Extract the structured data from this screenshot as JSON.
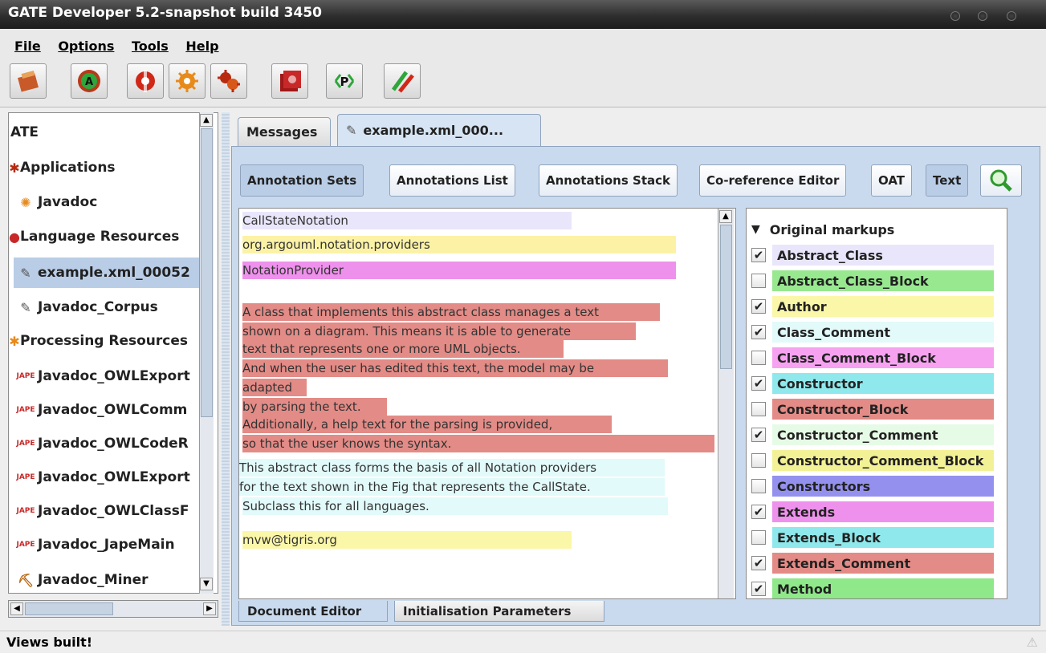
{
  "window": {
    "title": "GATE Developer 5.2-snapshot build 3450"
  },
  "menu": [
    "File",
    "Options",
    "Tools",
    "Help"
  ],
  "toolbar": {
    "icons": [
      "load-application-icon",
      "annie-icon",
      "new-language-resource-icon",
      "new-processing-resource-icon",
      "new-application-icon",
      "datastore-icon",
      "plugin-manager-icon",
      "annotation-diff-icon"
    ]
  },
  "tree": {
    "root": "ATE",
    "items": [
      {
        "label": "Applications",
        "icon": "applications-icon"
      },
      {
        "label": "Javadoc",
        "icon": "application-icon"
      },
      {
        "label": "Language Resources",
        "icon": "language-resources-icon"
      },
      {
        "label": "example.xml_00052",
        "icon": "document-icon"
      },
      {
        "label": "Javadoc_Corpus",
        "icon": "corpus-icon"
      },
      {
        "label": "Processing Resources",
        "icon": "processing-resources-icon"
      },
      {
        "label": "Javadoc_OWLExport",
        "icon": "jape-icon"
      },
      {
        "label": "Javadoc_OWLComm",
        "icon": "jape-icon"
      },
      {
        "label": "Javadoc_OWLCodeR",
        "icon": "jape-icon"
      },
      {
        "label": "Javadoc_OWLExport",
        "icon": "jape-icon"
      },
      {
        "label": "Javadoc_OWLClassF",
        "icon": "jape-icon"
      },
      {
        "label": "Javadoc_JapeMain",
        "icon": "jape-icon"
      },
      {
        "label": "Javadoc_Miner",
        "icon": "miner-icon"
      }
    ]
  },
  "jape_badge": "JAPE",
  "tabs": {
    "messages": "Messages",
    "doc": "example.xml_000..."
  },
  "view_buttons": [
    "Annotation Sets",
    "Annotations List",
    "Annotations Stack",
    "Co-reference Editor",
    "OAT",
    "Text"
  ],
  "text_lines": [
    {
      "text": "CallStateNotation",
      "color": "#e9e6fb"
    },
    {
      "text": "org.argouml.notation.providers",
      "color": "#fbf2a6"
    },
    {
      "text": "NotationProvider",
      "color": "#ee91ec"
    },
    {
      "text": "A class that implements this abstract class manages a text",
      "color": "#e38b86"
    },
    {
      "text": " shown on a diagram. This means it is able to generate",
      "color": "#e38b86"
    },
    {
      "text": " text that represents one or more UML objects.",
      "color": "#e38b86"
    },
    {
      "text": " And when the user has edited this text, the model may be",
      "color": "#e38b86"
    },
    {
      "text": "adapted",
      "color": "#e38b86"
    },
    {
      "text": " by parsing the text.",
      "color": "#e38b86"
    },
    {
      "text": " Additionally, a help text for the parsing is provided,",
      "color": "#e38b86"
    },
    {
      "text": " so that the user knows the syntax.",
      "color": "#e38b86"
    },
    {
      "text": "This abstract class forms the basis of all Notation providers",
      "color": "#e2fafa"
    },
    {
      "text": " for the text shown in the Fig that represents the CallState.",
      "color": "#e2fafa"
    },
    {
      "text": "Subclass this for all languages.",
      "color": "#e2fafa"
    },
    {
      "text": "mvw@tigris.org",
      "color": "#fbf7a8"
    }
  ],
  "annotations": {
    "header": "Original markups",
    "types": [
      {
        "name": "Abstract_Class",
        "checked": true,
        "color": "#e9e6fb"
      },
      {
        "name": "Abstract_Class_Block",
        "checked": false,
        "color": "#98e88f"
      },
      {
        "name": "Author",
        "checked": true,
        "color": "#fbf7a8"
      },
      {
        "name": "Class_Comment",
        "checked": true,
        "color": "#e2fafa"
      },
      {
        "name": "Class_Comment_Block",
        "checked": false,
        "color": "#f7a2f1"
      },
      {
        "name": "Constructor",
        "checked": true,
        "color": "#8fe8ec"
      },
      {
        "name": "Constructor_Block",
        "checked": false,
        "color": "#e38b86"
      },
      {
        "name": "Constructor_Comment",
        "checked": true,
        "color": "#e6fbe6"
      },
      {
        "name": "Constructor_Comment_Block",
        "checked": false,
        "color": "#f3f196"
      },
      {
        "name": "Constructors",
        "checked": false,
        "color": "#9491ee"
      },
      {
        "name": "Extends",
        "checked": true,
        "color": "#ee91ec"
      },
      {
        "name": "Extends_Block",
        "checked": false,
        "color": "#8fe8ec"
      },
      {
        "name": "Extends_Comment",
        "checked": true,
        "color": "#e38b86"
      },
      {
        "name": "Method",
        "checked": true,
        "color": "#8fe88a"
      }
    ]
  },
  "bottom_tabs": [
    "Document Editor",
    "Initialisation Parameters"
  ],
  "status": "Views built!"
}
